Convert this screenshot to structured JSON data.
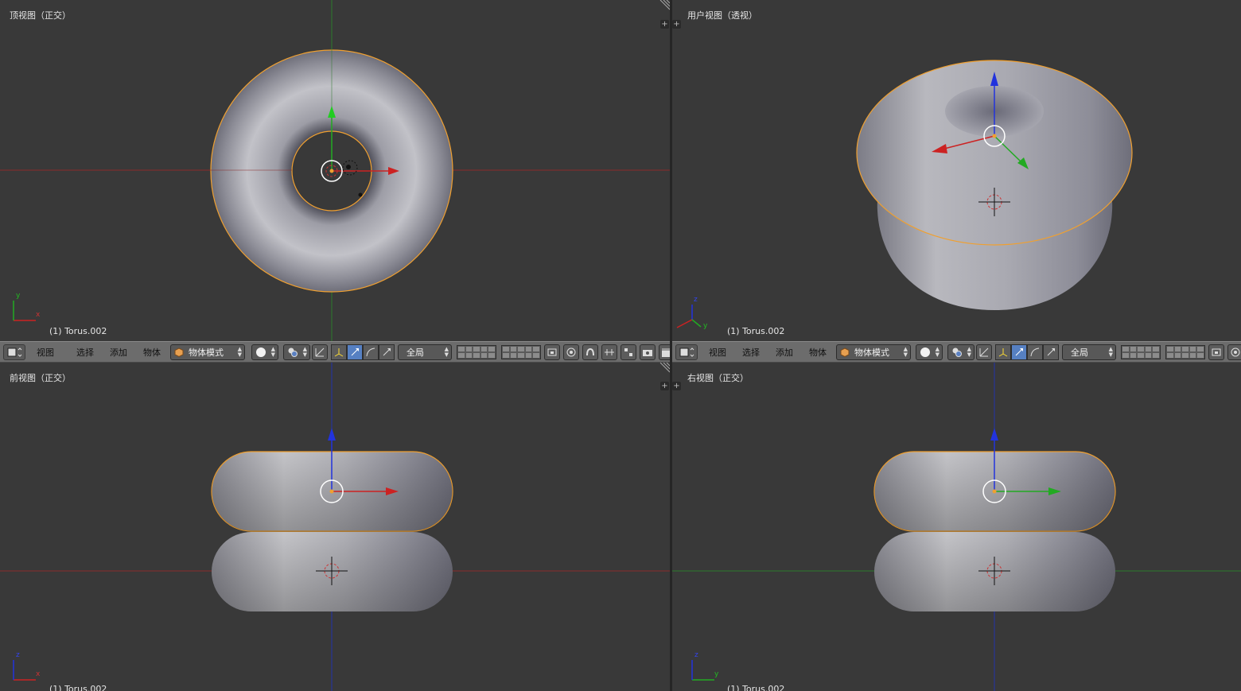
{
  "viewports": {
    "top": {
      "title": "顶视图（正交）",
      "object": "(1) Torus.002",
      "axis_a": "y",
      "axis_b": "x"
    },
    "user": {
      "title": "用户视图（透视）",
      "object": "(1) Torus.002",
      "axis_a": "z",
      "axis_b": "y"
    },
    "front": {
      "title": "前视图（正交）",
      "object": "(1) Torus.002",
      "axis_a": "z",
      "axis_b": "x"
    },
    "right": {
      "title": "右视图（正交）",
      "object": "(1) Torus.002",
      "axis_a": "z",
      "axis_b": "y"
    }
  },
  "header_left": {
    "menus": {
      "view": "视图",
      "select": "选择",
      "add": "添加",
      "object": "物体"
    },
    "mode": "物体模式",
    "pivot": "全局"
  },
  "header_right": {
    "menus": {
      "view": "视图",
      "select": "选择",
      "add": "添加",
      "object": "物体"
    },
    "mode": "物体模式",
    "pivot": "全局"
  },
  "corner_plus": "+",
  "colors": {
    "x_axis": "#cc2222",
    "y_axis": "#22aa22",
    "z_axis": "#2233dd",
    "selection_outline": "#f0a030",
    "viewport_bg": "#393939",
    "header_bg": "#6c6c6c"
  }
}
